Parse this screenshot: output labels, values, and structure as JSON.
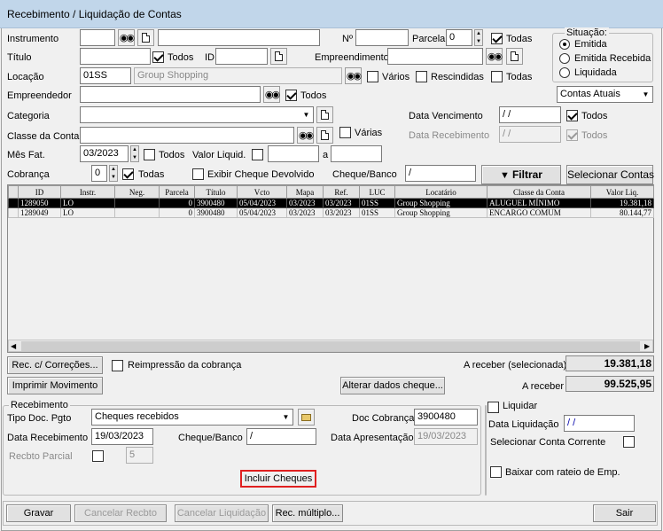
{
  "title": "Recebimento / Liquidação de Contas",
  "filters": {
    "instrumento_label": "Instrumento",
    "instrumento_value": "",
    "instrumento_desc": "",
    "numero_label": "Nº",
    "numero_value": "",
    "parcela_label": "Parcela",
    "parcela_value": "0",
    "parcela_todas": "Todas",
    "titulo_label": "Título",
    "titulo_value": "",
    "titulo_todos": "Todos",
    "id_label": "ID",
    "id_value": "",
    "empreendimento_label": "Empreendimento",
    "empreendimento_value": "",
    "locacao_label": "Locação",
    "locacao_code": "01SS",
    "locacao_name": "Group Shopping",
    "varios": "Vários",
    "rescindidas": "Rescindidas",
    "locacao_todas": "Todas",
    "empreendedor_label": "Empreendedor",
    "empreendedor_value": "",
    "empreendedor_todos": "Todos",
    "categoria_label": "Categoria",
    "categoria_value": "",
    "data_vencimento_label": "Data Vencimento",
    "data_vencimento_value": " / /",
    "dv_todos": "Todos",
    "classe_label": "Classe da Conta",
    "classe_value": "",
    "classe_varias": "Várias",
    "data_recebimento_label": "Data Recebimento",
    "data_recebimento_value": " / /",
    "dr_todos": "Todos",
    "mes_fat_label": "Mês Fat.",
    "mes_fat_value": "03/2023",
    "mes_todos": "Todos",
    "valor_liquid_label": "Valor Liquid.",
    "valor_de": "",
    "a_label": "a",
    "valor_ate": "",
    "cobranca_label": "Cobrança",
    "cobranca_value": "0",
    "cobranca_todas": "Todas",
    "exibir_cheque": "Exibir Cheque Devolvido",
    "cheque_banco_label": "Cheque/Banco",
    "cheque_banco_value": " /",
    "filtrar": "Filtrar",
    "selecionar_contas": "Selecionar Contas"
  },
  "situacao": {
    "title": "Situação:",
    "options": [
      "Emitida",
      "Emitida Recebida",
      "Liquidada"
    ],
    "selected": "Emitida",
    "contas": "Contas Atuais"
  },
  "grid": {
    "columns": [
      "ID",
      "Instr.",
      "Neg.",
      "Parcela",
      "Título",
      "Vcto",
      "Mapa",
      "Ref.",
      "LUC",
      "Locatário",
      "Classe da Conta",
      "Valor Liq."
    ],
    "rows": [
      [
        "1289050",
        "LO",
        "",
        "0",
        "3900480",
        "05/04/2023",
        "03/2023",
        "03/2023",
        "01SS",
        "Group Shopping",
        "ALUGUEL MÍNIMO",
        "19.381,18"
      ],
      [
        "1289049",
        "LO",
        "",
        "0",
        "3900480",
        "05/04/2023",
        "03/2023",
        "03/2023",
        "01SS",
        "Group Shopping",
        "ENCARGO COMUM",
        "80.144,77"
      ]
    ]
  },
  "actions": {
    "rec_correcoes": "Rec. c/ Correções...",
    "reimpressao": "Reimpressão da cobrança",
    "imprimir": "Imprimir Movimento",
    "alterar_cheque": "Alterar dados cheque...",
    "a_receber_sel_label": "A receber (selecionada)",
    "a_receber_sel_value": "19.381,18",
    "a_receber_label": "A receber",
    "a_receber_value": "99.525,95"
  },
  "recebimento": {
    "title": "Recebimento",
    "tipo_doc_label": "Tipo Doc. Pgto",
    "tipo_doc_value": "Cheques recebidos",
    "doc_cobranca_label": "Doc Cobrança",
    "doc_cobranca_value": "3900480",
    "data_recebimento_label": "Data Recebimento",
    "data_recebimento_value": "19/03/2023",
    "cheque_banco_label": "Cheque/Banco",
    "cheque_banco_value": " /",
    "data_apresentacao_label": "Data Apresentação",
    "data_apresentacao_value": "19/03/2023",
    "recbto_parcial_label": "Recbto Parcial",
    "recbto_parcial_value": "5",
    "incluir_cheques": "Incluir Cheques"
  },
  "liquidar": {
    "title": "Liquidar",
    "data_liq_label": "Data Liquidação",
    "data_liq_value": " / /",
    "sel_conta": "Selecionar Conta Corrente",
    "baixar": "Baixar com rateio de Emp."
  },
  "footer": {
    "gravar": "Gravar",
    "cancelar_recbto": "Cancelar Recbto",
    "cancelar_liquidacao": "Cancelar Liquidação",
    "rec_multiplo": "Rec. múltiplo...",
    "sair": "Sair"
  }
}
